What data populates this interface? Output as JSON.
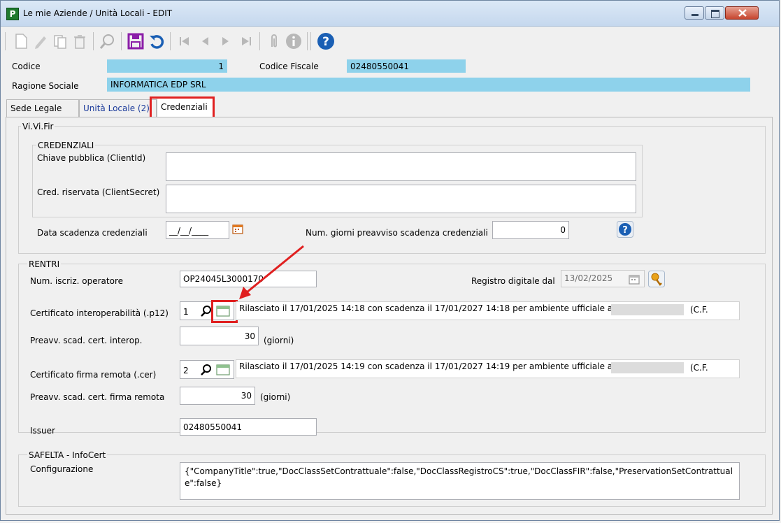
{
  "window": {
    "title": "Le mie Aziende / Unità Locali - EDIT",
    "app_icon": "P"
  },
  "header": {
    "codice_label": "Codice",
    "codice_value": "1",
    "cf_label": "Codice Fiscale",
    "cf_value": "02480550041",
    "ragione_label": "Ragione Sociale",
    "ragione_value": "INFORMATICA EDP SRL"
  },
  "tabs": [
    {
      "label": "Sede Legale"
    },
    {
      "label": "Unità Locale (2)"
    },
    {
      "label": "Credenziali"
    }
  ],
  "vivifir": {
    "group_label": "Vi.Vi.Fir",
    "credenziali_label": "CREDENZIALI",
    "client_id_label": "Chiave pubblica (ClientId)",
    "client_id_value": "",
    "client_secret_label": "Cred. riservata (ClientSecret)",
    "client_secret_value": "",
    "scadenza_label": "Data scadenza credenziali",
    "scadenza_value": "__/__/____",
    "preavviso_label": "Num. giorni preavviso scadenza credenziali",
    "preavviso_value": "0"
  },
  "rentri": {
    "group_label": "RENTRI",
    "iscriz_label": "Num. iscriz. operatore",
    "iscriz_value": "OP24045L3000170",
    "registro_label": "Registro digitale dal",
    "registro_value": "13/02/2025",
    "cert_interop_label": "Certificato interoperabilità (.p12)",
    "cert_interop_value": "1",
    "cert_interop_info": "Rilasciato il 17/01/2025 14:18 con scadenza il 17/01/2027 14:18 per ambiente ufficiale a",
    "cert_interop_cf": "(C.F.",
    "preavv_interop_label": "Preavv. scad. cert. interop.",
    "preavv_interop_value": "30",
    "preavv_interop_unit": "(giorni)",
    "cert_firma_label": "Certificato firma remota (.cer)",
    "cert_firma_value": "2",
    "cert_firma_info": "Rilasciato il 17/01/2025 14:19 con scadenza il 17/01/2027 14:19 per ambiente ufficiale a",
    "cert_firma_cf": "(C.F.",
    "preavv_firma_label": "Preavv. scad. cert. firma remota",
    "preavv_firma_value": "30",
    "preavv_firma_unit": "(giorni)",
    "issuer_label": "Issuer",
    "issuer_value": "02480550041"
  },
  "safelta": {
    "group_label": "SAFELTA - InfoCert",
    "config_label": "Configurazione",
    "config_value": "{\"CompanyTitle\":true,\"DocClassSetContrattuale\":false,\"DocClassRegistroCS\":true,\"DocClassFIR\":false,\"PreservationSetContrattuale\":false}"
  },
  "colors": {
    "highlight_field": "#8ed2eb",
    "annotation": "#e02020",
    "tab_blue": "#1a3a9a"
  }
}
